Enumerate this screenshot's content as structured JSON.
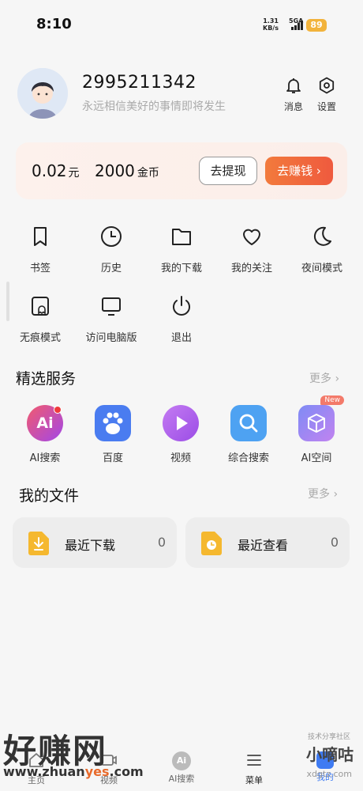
{
  "status_bar": {
    "time": "8:10",
    "net_speed_value": "1.31",
    "net_speed_unit": "KB/s",
    "network": "5GA",
    "battery": "89"
  },
  "profile": {
    "user_id": "2995211342",
    "motto": "永远相信美好的事情即将发生",
    "messages_label": "消息",
    "settings_label": "设置"
  },
  "wallet": {
    "cash_value": "0.02",
    "cash_unit": "元",
    "coins_value": "2000",
    "coins_unit": "金币",
    "withdraw_label": "去提现",
    "earn_label": "去赚钱"
  },
  "shortcuts": [
    {
      "label": "书签",
      "icon": "bookmark-icon"
    },
    {
      "label": "历史",
      "icon": "clock-icon"
    },
    {
      "label": "我的下载",
      "icon": "folder-icon"
    },
    {
      "label": "我的关注",
      "icon": "heart-icon"
    },
    {
      "label": "夜间模式",
      "icon": "moon-icon"
    },
    {
      "label": "无痕模式",
      "icon": "ghost-icon"
    },
    {
      "label": "访问电脑版",
      "icon": "monitor-icon"
    },
    {
      "label": "退出",
      "icon": "power-icon"
    }
  ],
  "featured": {
    "title": "精选服务",
    "more": "更多",
    "items": [
      {
        "label": "AI搜索",
        "icon": "ai-search-icon",
        "text": "Ai"
      },
      {
        "label": "百度",
        "icon": "baidu-paw-icon"
      },
      {
        "label": "视频",
        "icon": "video-play-icon"
      },
      {
        "label": "综合搜索",
        "icon": "search-icon"
      },
      {
        "label": "AI空间",
        "icon": "ai-space-cube-icon",
        "badge": "New"
      }
    ]
  },
  "files": {
    "title": "我的文件",
    "more": "更多",
    "items": [
      {
        "label": "最近下载",
        "count": "0",
        "icon": "download-file-icon"
      },
      {
        "label": "最近查看",
        "count": "0",
        "icon": "recent-file-icon"
      }
    ]
  },
  "bottom_nav": [
    {
      "label": "主页",
      "icon": "home-icon"
    },
    {
      "label": "视频",
      "icon": "video-icon"
    },
    {
      "label": "AI搜索",
      "icon": "ai-icon",
      "text": "Ai"
    },
    {
      "label": "菜单",
      "icon": "menu-icon"
    },
    {
      "label": "我的",
      "icon": "profile-icon"
    }
  ],
  "watermark": {
    "left_title": "好赚网",
    "left_url_a": "www.zhuan",
    "left_url_hl": "yes",
    "left_url_b": ".com",
    "right_top": "技术分享社区",
    "right_title": "小嘀咕",
    "right_url": "xdgtz.com"
  },
  "colors": {
    "accent": "#ef5a3e",
    "battery": "#f2b33c",
    "background": "#f6f6f6"
  }
}
